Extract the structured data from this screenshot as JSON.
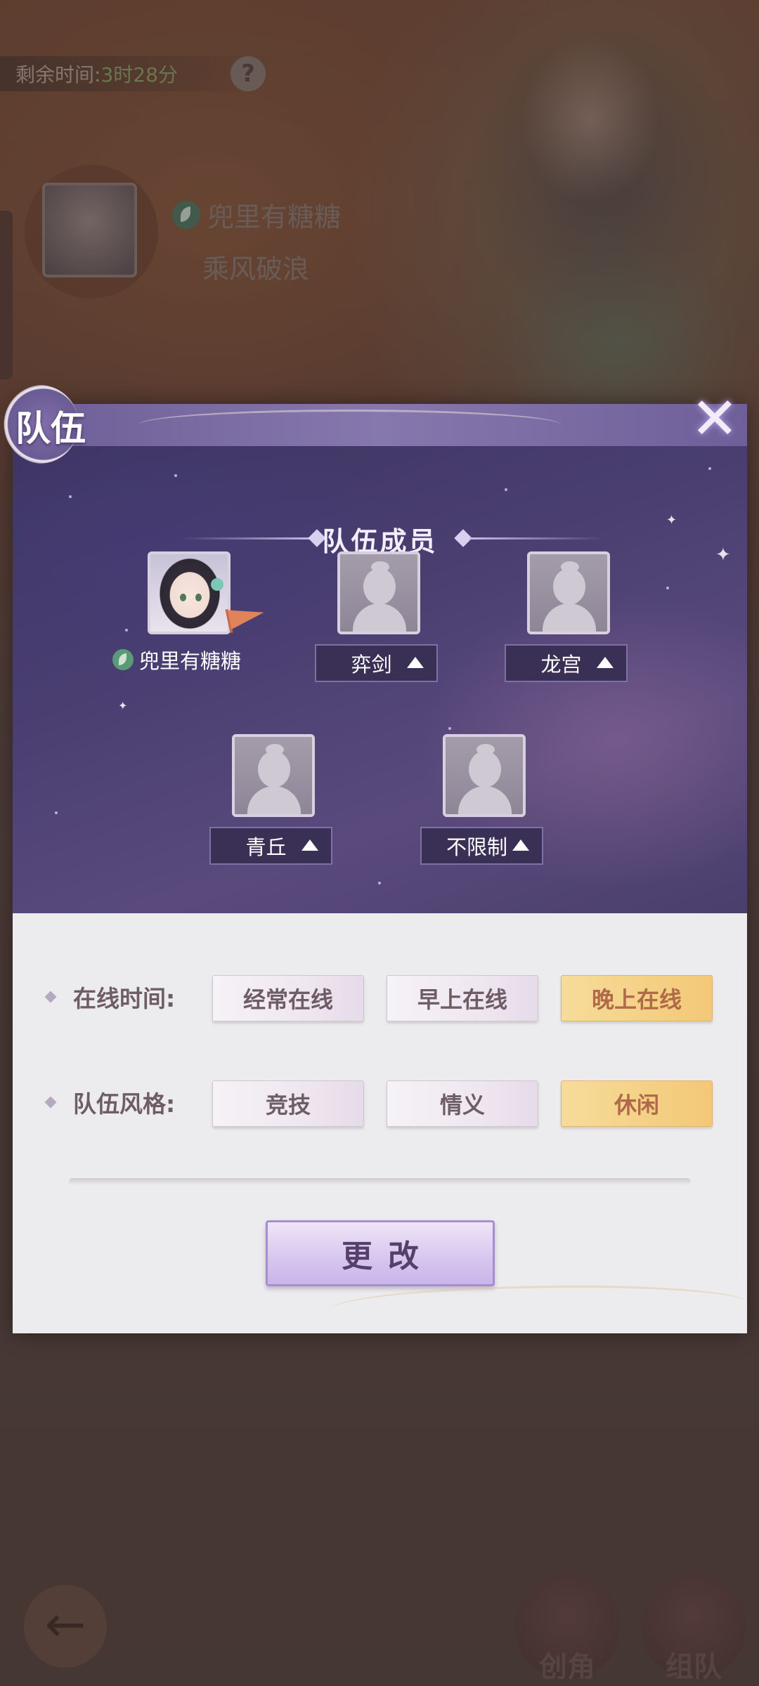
{
  "background": {
    "timer_label": "剩余时间:",
    "timer_value": "3时28分",
    "help_glyph": "?",
    "player_name": "兜里有糖糖",
    "player_title": "乘风破浪",
    "back_glyph": "←",
    "nav": [
      {
        "label": "创角"
      },
      {
        "label": "组队"
      }
    ]
  },
  "dialog": {
    "title": "队伍",
    "close_glyph": "✕",
    "members_section_title": "队伍成员",
    "leader": {
      "name": "兜里有糖糖"
    },
    "slots": [
      {
        "label": "弈剑"
      },
      {
        "label": "龙宫"
      },
      {
        "label": "青丘"
      },
      {
        "label": "不限制"
      }
    ],
    "online_time": {
      "label": "在线时间:",
      "options": [
        "经常在线",
        "早上在线",
        "晚上在线"
      ],
      "selected": "晚上在线"
    },
    "team_style": {
      "label": "队伍风格:",
      "options": [
        "竞技",
        "情义",
        "休闲"
      ],
      "selected": "休闲"
    },
    "change_button": "更改"
  },
  "colors": {
    "panel_purple": "#4b3f72",
    "selected_gold": "#f3c877",
    "option_text": "#6f5d66"
  }
}
